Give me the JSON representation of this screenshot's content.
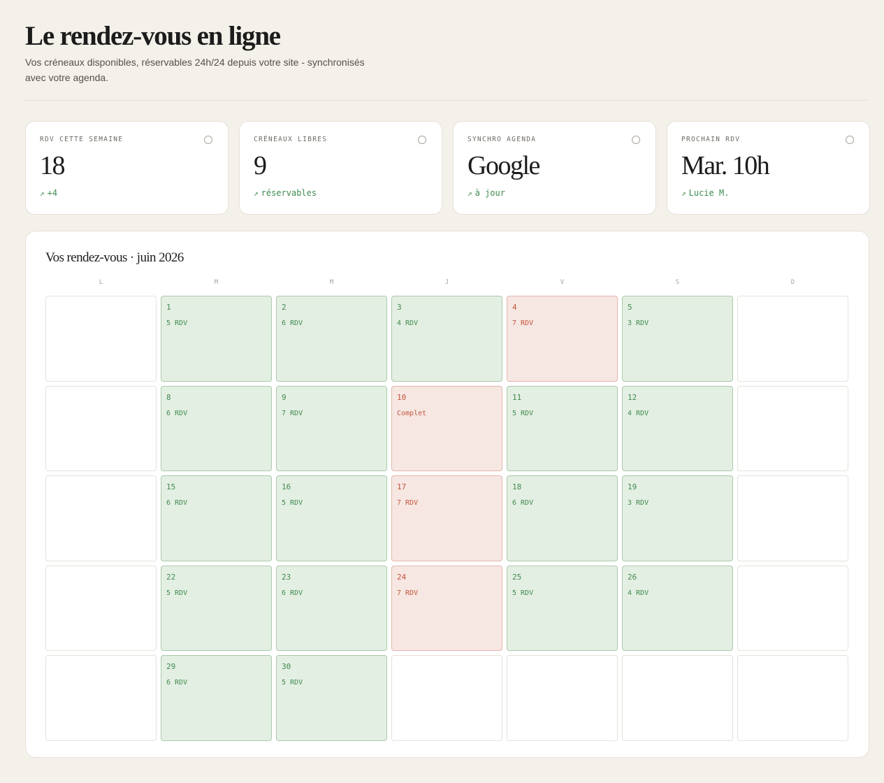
{
  "header": {
    "title": "Le rendez-vous en ligne",
    "subtitle": "Vos créneaux disponibles, réservables 24h/24 depuis votre site - synchronisés avec votre agenda."
  },
  "stats": [
    {
      "label": "RDV CETTE SEMAINE",
      "value": "18",
      "trend": "+4",
      "trend_icon": "arrow-up-right-icon"
    },
    {
      "label": "CRÉNEAUX LIBRES",
      "value": "9",
      "trend": "réservables",
      "trend_icon": "arrow-up-right-icon"
    },
    {
      "label": "SYNCHRO AGENDA",
      "value": "Google",
      "trend": "à jour",
      "trend_icon": "arrow-up-right-icon"
    },
    {
      "label": "PROCHAIN RDV",
      "value": "Mar. 10h",
      "trend": "Lucie M.",
      "trend_icon": "arrow-up-right-icon"
    }
  ],
  "calendar": {
    "title": "Vos rendez-vous · juin 2026",
    "weekdays": [
      "L",
      "M",
      "M",
      "J",
      "V",
      "S",
      "D"
    ],
    "colors": {
      "available_bg": "#e4efe3",
      "available_text": "#3f8a4e",
      "busy_bg": "#f6e7e3",
      "busy_text": "#c4553c"
    },
    "weeks": [
      [
        {
          "day": "",
          "status": "",
          "state": "empty"
        },
        {
          "day": "1",
          "status": "5 RDV",
          "state": "avail"
        },
        {
          "day": "2",
          "status": "6 RDV",
          "state": "avail"
        },
        {
          "day": "3",
          "status": "4 RDV",
          "state": "avail"
        },
        {
          "day": "4",
          "status": "7 RDV",
          "state": "busy"
        },
        {
          "day": "5",
          "status": "3 RDV",
          "state": "avail"
        },
        {
          "day": "",
          "status": "",
          "state": "empty"
        }
      ],
      [
        {
          "day": "",
          "status": "",
          "state": "empty"
        },
        {
          "day": "8",
          "status": "6 RDV",
          "state": "avail"
        },
        {
          "day": "9",
          "status": "7 RDV",
          "state": "avail"
        },
        {
          "day": "10",
          "status": "Complet",
          "state": "busy"
        },
        {
          "day": "11",
          "status": "5 RDV",
          "state": "avail"
        },
        {
          "day": "12",
          "status": "4 RDV",
          "state": "avail"
        },
        {
          "day": "",
          "status": "",
          "state": "empty"
        }
      ],
      [
        {
          "day": "",
          "status": "",
          "state": "empty"
        },
        {
          "day": "15",
          "status": "6 RDV",
          "state": "avail"
        },
        {
          "day": "16",
          "status": "5 RDV",
          "state": "avail"
        },
        {
          "day": "17",
          "status": "7 RDV",
          "state": "busy"
        },
        {
          "day": "18",
          "status": "6 RDV",
          "state": "avail"
        },
        {
          "day": "19",
          "status": "3 RDV",
          "state": "avail"
        },
        {
          "day": "",
          "status": "",
          "state": "empty"
        }
      ],
      [
        {
          "day": "",
          "status": "",
          "state": "empty"
        },
        {
          "day": "22",
          "status": "5 RDV",
          "state": "avail"
        },
        {
          "day": "23",
          "status": "6 RDV",
          "state": "avail"
        },
        {
          "day": "24",
          "status": "7 RDV",
          "state": "busy"
        },
        {
          "day": "25",
          "status": "5 RDV",
          "state": "avail"
        },
        {
          "day": "26",
          "status": "4 RDV",
          "state": "avail"
        },
        {
          "day": "",
          "status": "",
          "state": "empty"
        }
      ],
      [
        {
          "day": "",
          "status": "",
          "state": "empty"
        },
        {
          "day": "29",
          "status": "6 RDV",
          "state": "avail"
        },
        {
          "day": "30",
          "status": "5 RDV",
          "state": "avail"
        },
        {
          "day": "",
          "status": "",
          "state": "empty"
        },
        {
          "day": "",
          "status": "",
          "state": "empty"
        },
        {
          "day": "",
          "status": "",
          "state": "empty"
        },
        {
          "day": "",
          "status": "",
          "state": "empty"
        }
      ]
    ]
  }
}
